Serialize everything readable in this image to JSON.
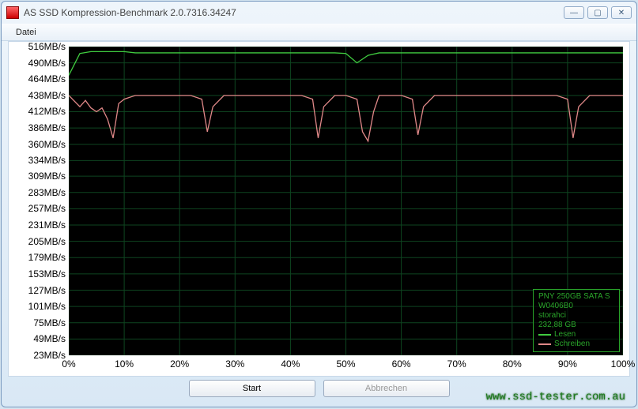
{
  "window": {
    "title": "AS SSD Kompression-Benchmark 2.0.7316.34247"
  },
  "menu": {
    "file": "Datei"
  },
  "buttons": {
    "start": "Start",
    "cancel": "Abbrechen"
  },
  "legend": {
    "device": "PNY 250GB SATA S",
    "fw": "W0406B0",
    "driver": "storahci",
    "capacity": "232,88 GB",
    "read": "Lesen",
    "write": "Schreiben"
  },
  "watermark": "www.ssd-tester.com.au",
  "chart_data": {
    "type": "line",
    "xlabel": "",
    "ylabel": "",
    "x_unit": "%",
    "y_unit": "MB/s",
    "ylim": [
      23,
      516
    ],
    "xlim": [
      0,
      100
    ],
    "y_ticks": [
      516,
      490,
      464,
      438,
      412,
      386,
      360,
      334,
      309,
      283,
      257,
      231,
      205,
      179,
      153,
      127,
      101,
      75,
      49,
      23
    ],
    "y_tick_labels": [
      "516MB/s",
      "490MB/s",
      "464MB/s",
      "438MB/s",
      "412MB/s",
      "386MB/s",
      "360MB/s",
      "334MB/s",
      "309MB/s",
      "283MB/s",
      "257MB/s",
      "231MB/s",
      "205MB/s",
      "179MB/s",
      "153MB/s",
      "127MB/s",
      "101MB/s",
      "75MB/s",
      "49MB/s",
      "23MB/s"
    ],
    "x_ticks": [
      0,
      10,
      20,
      30,
      40,
      50,
      60,
      70,
      80,
      90,
      100
    ],
    "x_tick_labels": [
      "0%",
      "10%",
      "20%",
      "30%",
      "40%",
      "50%",
      "60%",
      "70%",
      "80%",
      "90%",
      "100%"
    ],
    "series": [
      {
        "name": "Lesen",
        "color": "#40cc40",
        "x": [
          0,
          2,
          4,
          6,
          8,
          10,
          12,
          14,
          16,
          18,
          20,
          22,
          24,
          26,
          28,
          30,
          32,
          34,
          36,
          38,
          40,
          42,
          44,
          46,
          48,
          50,
          52,
          54,
          56,
          58,
          60,
          62,
          64,
          66,
          68,
          70,
          72,
          74,
          76,
          78,
          80,
          82,
          84,
          86,
          88,
          90,
          92,
          94,
          96,
          98,
          100
        ],
        "y": [
          470,
          505,
          508,
          508,
          508,
          508,
          506,
          506,
          506,
          506,
          506,
          506,
          506,
          506,
          506,
          506,
          506,
          506,
          506,
          506,
          506,
          506,
          506,
          506,
          506,
          505,
          490,
          502,
          506,
          506,
          506,
          506,
          506,
          506,
          506,
          506,
          506,
          506,
          506,
          506,
          506,
          506,
          506,
          506,
          506,
          506,
          506,
          506,
          506,
          506,
          506
        ]
      },
      {
        "name": "Schreiben",
        "color": "#e08888",
        "x": [
          0,
          2,
          3,
          4,
          5,
          6,
          7,
          8,
          9,
          10,
          12,
          14,
          16,
          18,
          20,
          22,
          24,
          25,
          26,
          28,
          30,
          32,
          34,
          36,
          38,
          40,
          42,
          44,
          45,
          46,
          48,
          50,
          52,
          53,
          54,
          55,
          56,
          58,
          60,
          62,
          63,
          64,
          66,
          68,
          70,
          72,
          74,
          76,
          78,
          80,
          82,
          84,
          86,
          88,
          90,
          91,
          92,
          94,
          96,
          98,
          100
        ],
        "y": [
          438,
          420,
          430,
          418,
          412,
          418,
          400,
          370,
          425,
          432,
          438,
          438,
          438,
          438,
          438,
          438,
          432,
          380,
          420,
          438,
          438,
          438,
          438,
          438,
          438,
          438,
          438,
          432,
          370,
          420,
          438,
          438,
          432,
          380,
          365,
          412,
          438,
          438,
          438,
          432,
          375,
          420,
          438,
          438,
          438,
          438,
          438,
          438,
          438,
          438,
          438,
          438,
          438,
          438,
          432,
          370,
          420,
          438,
          438,
          438,
          438
        ]
      }
    ]
  }
}
